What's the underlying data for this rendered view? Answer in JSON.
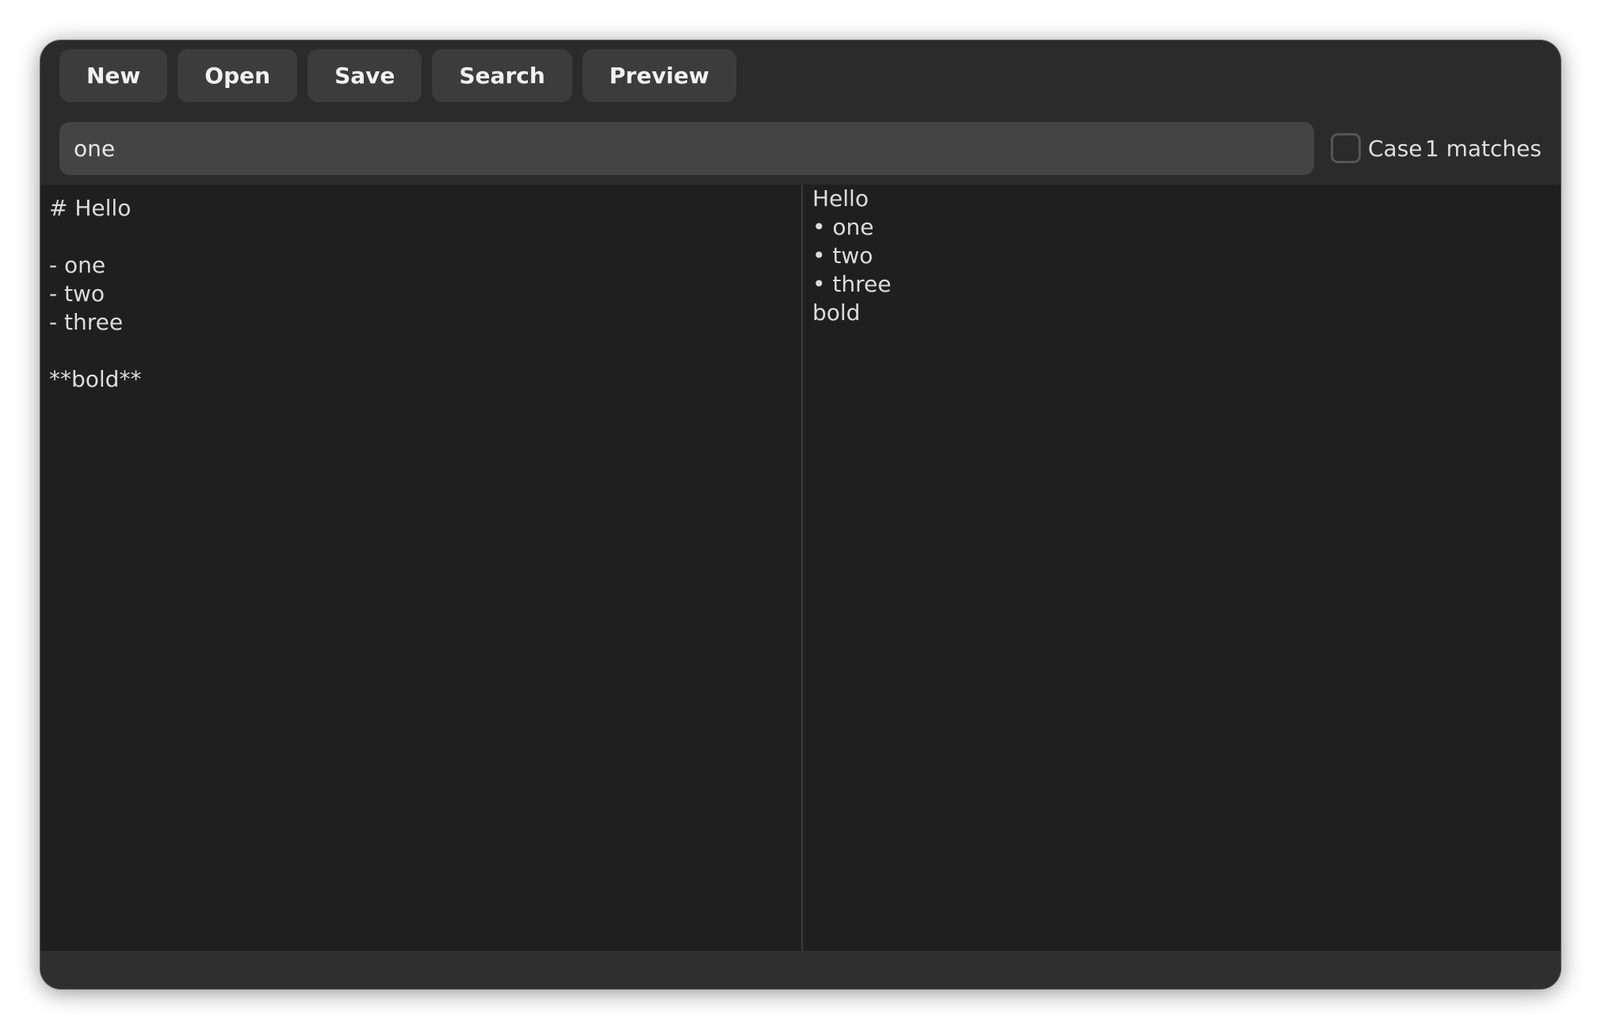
{
  "toolbar": {
    "buttons": [
      "New",
      "Open",
      "Save",
      "Search",
      "Preview"
    ]
  },
  "search": {
    "query": "one",
    "case_label": "Case",
    "case_checked": false,
    "match_count": "1 matches"
  },
  "editor": {
    "lines": [
      "# Hello",
      "",
      "- one",
      "- two",
      "- three",
      "",
      "**bold**"
    ]
  },
  "preview": {
    "lines": [
      "Hello",
      "• one",
      "• two",
      "• three",
      "bold"
    ]
  },
  "colors": {
    "window_bg": "#2b2b2b",
    "pane_bg": "#1f1f20",
    "button_bg": "#3c3c3c",
    "input_bg": "#444444",
    "text": "#dcdcdc"
  }
}
